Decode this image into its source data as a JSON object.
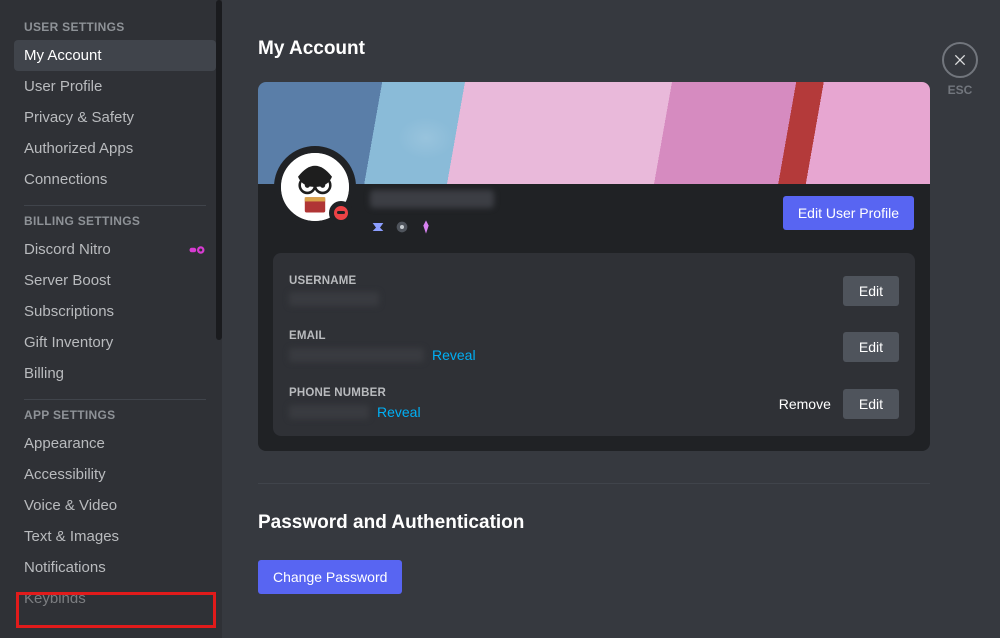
{
  "sidebar": {
    "user_settings_header": "USER SETTINGS",
    "billing_settings_header": "BILLING SETTINGS",
    "app_settings_header": "APP SETTINGS",
    "items_user": [
      "My Account",
      "User Profile",
      "Privacy & Safety",
      "Authorized Apps",
      "Connections"
    ],
    "items_billing": [
      "Discord Nitro",
      "Server Boost",
      "Subscriptions",
      "Gift Inventory",
      "Billing"
    ],
    "items_app": [
      "Appearance",
      "Accessibility",
      "Voice & Video",
      "Text & Images",
      "Notifications",
      "Keybinds"
    ],
    "selected": "My Account",
    "highlighted": "Notifications"
  },
  "close": {
    "esc_label": "ESC"
  },
  "page": {
    "title": "My Account",
    "edit_profile_btn": "Edit User Profile",
    "fields": {
      "username": {
        "label": "USERNAME",
        "edit": "Edit"
      },
      "email": {
        "label": "EMAIL",
        "reveal": "Reveal",
        "edit": "Edit"
      },
      "phone": {
        "label": "PHONE NUMBER",
        "reveal": "Reveal",
        "remove": "Remove",
        "edit": "Edit"
      }
    },
    "pwd_section_title": "Password and Authentication",
    "change_pwd_btn": "Change Password"
  }
}
